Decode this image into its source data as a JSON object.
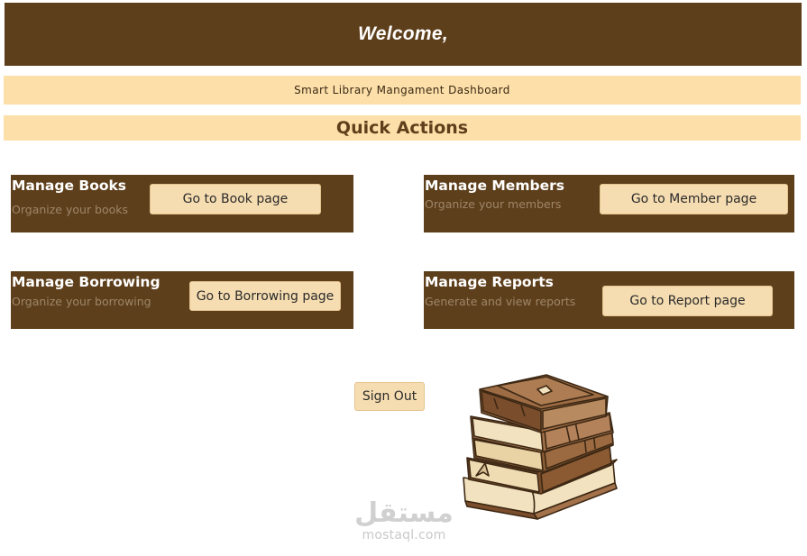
{
  "header": {
    "title": "Welcome,"
  },
  "subtitle": "Smart Library Mangament Dashboard",
  "quick_actions": {
    "heading": "Quick Actions"
  },
  "cards": [
    {
      "title": "Manage Books",
      "subtitle": "Organize your books",
      "button_label": "Go to Book page"
    },
    {
      "title": "Manage Members",
      "subtitle": "Organize your members",
      "button_label": "Go to Member page"
    },
    {
      "title": "Manage Borrowing",
      "subtitle": "Organize your borrowing",
      "button_label": "Go to Borrowing page"
    },
    {
      "title": "Manage Reports",
      "subtitle": "Generate and view reports",
      "button_label": "Go to Report page"
    }
  ],
  "sign_out_label": "Sign Out",
  "watermark": {
    "logo_text": "مستقل",
    "site": "mostaql.com"
  },
  "colors": {
    "primary": "#5e3f1b",
    "accent": "#fddfa9",
    "button": "#f6ddb1",
    "muted_text": "#9d8669"
  },
  "icons": {
    "illustration": "stack-of-books-icon"
  }
}
